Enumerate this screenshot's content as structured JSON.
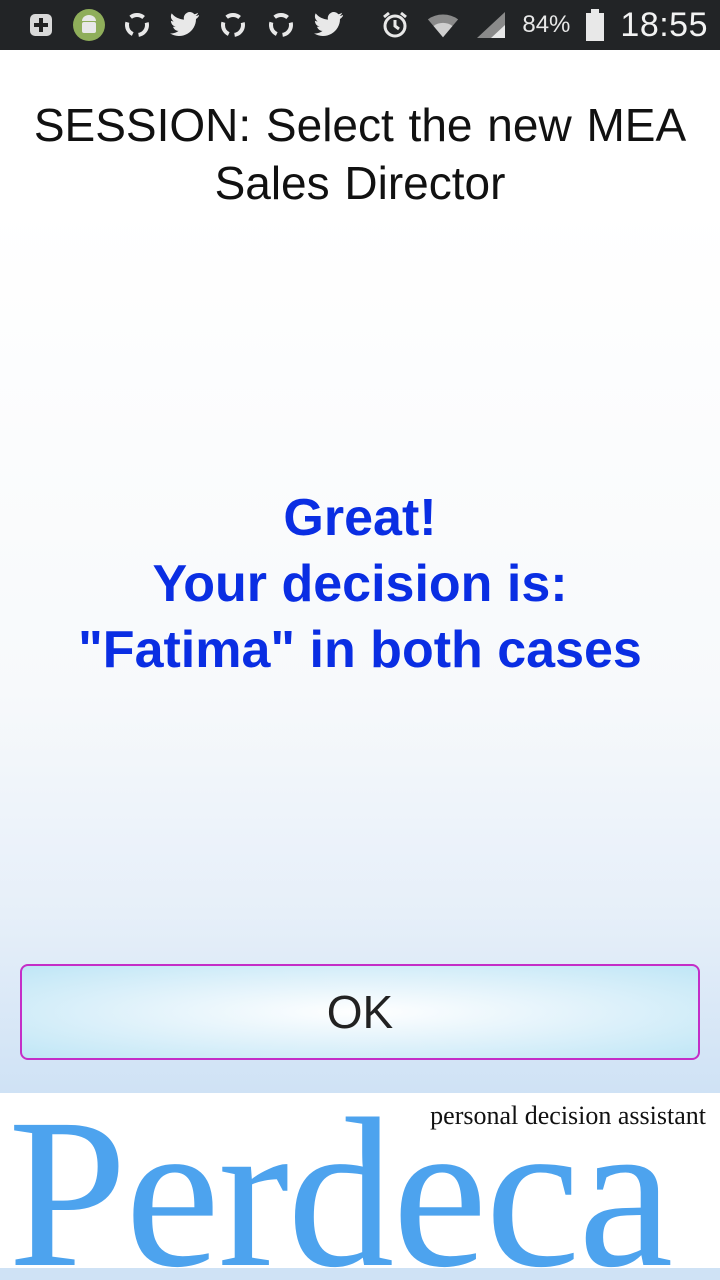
{
  "status_bar": {
    "battery_percent": "84%",
    "time": "18:55",
    "icons_left": [
      "add-icon",
      "android-icon",
      "sync-icon",
      "twitter-icon",
      "sync-icon",
      "sync-icon",
      "twitter-icon"
    ],
    "icons_right": [
      "alarm-icon",
      "wifi-icon",
      "signal-icon",
      "battery-icon"
    ]
  },
  "session": {
    "title": "SESSION: Select the new  MEA Sales Director"
  },
  "result": {
    "line1": "Great!",
    "line2": "Your decision is:",
    "line3": "\"Fatima\" in both cases",
    "color": "#0a2ee3"
  },
  "ok_button": {
    "label": "OK",
    "border_color": "#c42ec7"
  },
  "brand": {
    "name": "Perdeca",
    "tagline": "personal decision assistant",
    "color": "#4da3ee"
  }
}
